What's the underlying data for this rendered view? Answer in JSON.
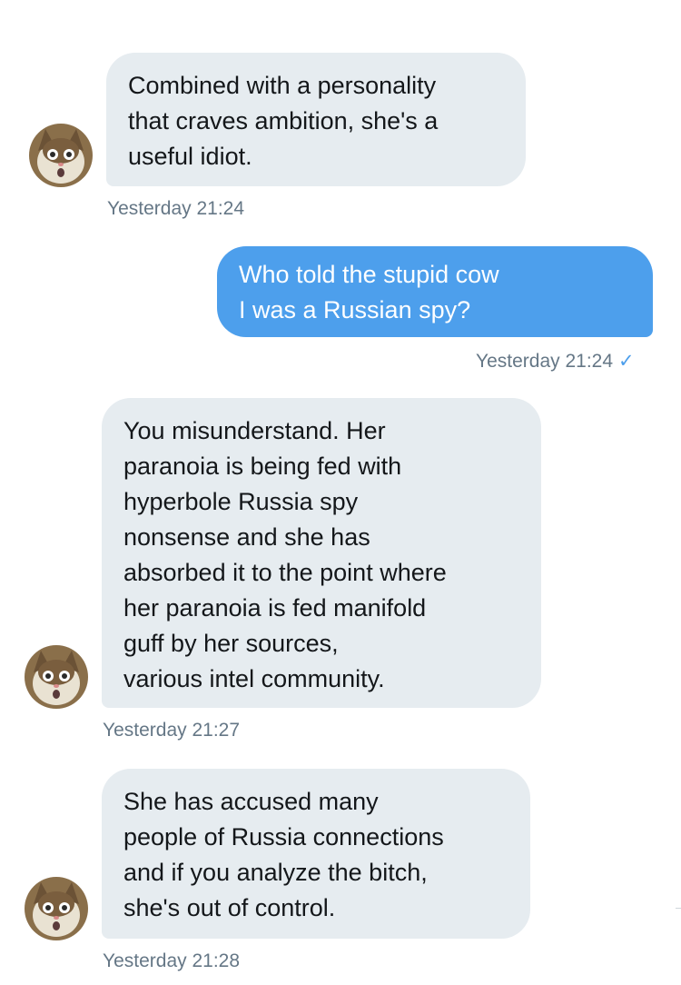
{
  "messages": [
    {
      "direction": "received",
      "text": "Combined with a personality\nthat craves ambition, she's a\nuseful idiot.",
      "timestamp": "Yesterday 21:24"
    },
    {
      "direction": "sent",
      "text": "Who told the stupid cow\nI was a Russian spy?",
      "timestamp": "Yesterday 21:24",
      "read_icon": "✓"
    },
    {
      "direction": "received",
      "text": "You misunderstand.  Her\nparanoia is being fed with\nhyperbole Russia spy\nnonsense and she has\nabsorbed it to the point where\nher paranoia is fed manifold\nguff by her sources,\nvarious intel community.",
      "timestamp": "Yesterday 21:27"
    },
    {
      "direction": "received",
      "text": "She has accused many\npeople of Russia connections\nand if you analyze the bitch,\nshe's out of control.",
      "timestamp": "Yesterday 21:28"
    }
  ],
  "avatar_icon": "cat-avatar-icon",
  "colors": {
    "sent_bubble": "#4d9fec",
    "received_bubble": "#e6ecf0",
    "timestamp": "#657786",
    "text": "#14171a"
  }
}
